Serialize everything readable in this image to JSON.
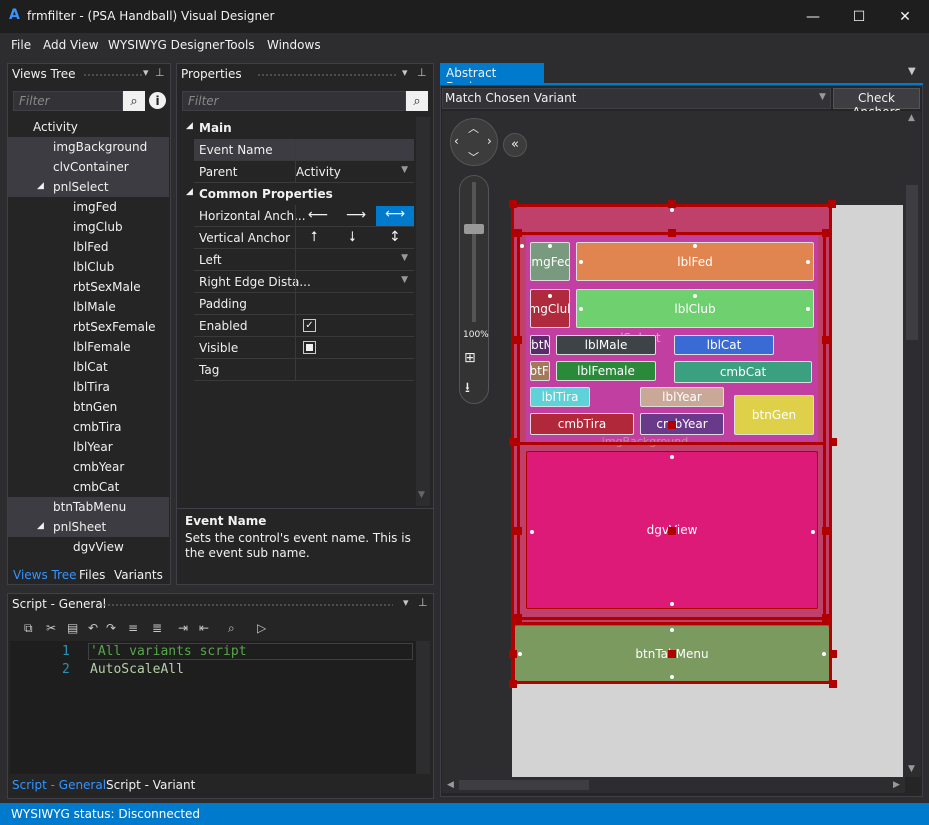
{
  "window": {
    "title": "frmfilter - (PSA Handball) Visual Designer",
    "logo": "A",
    "minimize": "—",
    "maximize": "☐",
    "close": "✕"
  },
  "menu": [
    "File",
    "Add View",
    "WYSIWYG Designer",
    "Tools",
    "Windows"
  ],
  "views_tree": {
    "title": "Views Tree",
    "filter_placeholder": "Filter",
    "items": [
      {
        "label": "Activity",
        "indent": 0
      },
      {
        "label": "imgBackground",
        "indent": 1
      },
      {
        "label": "clvContainer",
        "indent": 1
      },
      {
        "label": "pnlSelect",
        "indent": 1,
        "expanded": true
      },
      {
        "label": "imgFed",
        "indent": 2
      },
      {
        "label": "imgClub",
        "indent": 2
      },
      {
        "label": "lblFed",
        "indent": 2
      },
      {
        "label": "lblClub",
        "indent": 2
      },
      {
        "label": "rbtSexMale",
        "indent": 2
      },
      {
        "label": "lblMale",
        "indent": 2
      },
      {
        "label": "rbtSexFemale",
        "indent": 2
      },
      {
        "label": "lblFemale",
        "indent": 2
      },
      {
        "label": "lblCat",
        "indent": 2
      },
      {
        "label": "lblTira",
        "indent": 2
      },
      {
        "label": "btnGen",
        "indent": 2
      },
      {
        "label": "cmbTira",
        "indent": 2
      },
      {
        "label": "lblYear",
        "indent": 2
      },
      {
        "label": "cmbYear",
        "indent": 2
      },
      {
        "label": "cmbCat",
        "indent": 2
      },
      {
        "label": "btnTabMenu",
        "indent": 1
      },
      {
        "label": "pnlSheet",
        "indent": 1,
        "expanded": true
      },
      {
        "label": "dgvView",
        "indent": 2
      }
    ],
    "tabs": [
      "Views Tree",
      "Files",
      "Variants"
    ]
  },
  "properties": {
    "title": "Properties",
    "filter_placeholder": "Filter",
    "section_main": "Main",
    "event_name_label": "Event Name",
    "event_name_value": "",
    "parent_label": "Parent",
    "parent_value": "Activity",
    "section_common": "Common Properties",
    "horizontal_anchor_label": "Horizontal Anch...",
    "vertical_anchor_label": "Vertical Anchor",
    "left_label": "Left",
    "right_edge_label": "Right Edge Dista...",
    "padding_label": "Padding",
    "enabled_label": "Enabled",
    "enabled_checked": true,
    "visible_label": "Visible",
    "visible_checked": false,
    "tag_label": "Tag",
    "help_title": "Event Name",
    "help_text": "Sets the control's event name. This is the event sub name."
  },
  "script": {
    "title": "Script - General",
    "lines": [
      {
        "num": "1",
        "text": "'All variants script"
      },
      {
        "num": "2",
        "text": "AutoScaleAll"
      }
    ],
    "tabs": [
      "Script - General",
      "Script - Variant"
    ]
  },
  "designer": {
    "tab": "Abstract Designer",
    "variant_select": "Match Chosen Variant",
    "check_anchors": "Check Anchors",
    "zoom": "100%",
    "controls": {
      "imgFed": "imgFed",
      "lblFed": "lblFed",
      "imgClub": "imgClub",
      "lblClub": "lblClub",
      "pnlSelect": "pnlSelect",
      "rbtMale": "rbtM",
      "lblMale": "lblMale",
      "lblCat": "lblCat",
      "rbtFemale": "rbtFe",
      "lblFemale": "lblFemale",
      "cmbCat": "cmbCat",
      "lblTira": "lblTira",
      "lblYear": "lblYear",
      "btnGen": "btnGen",
      "cmbTira": "cmbTira",
      "cmbYear": "cmbYear",
      "imgBackground": "imgBackground",
      "dgvView": "dgvView",
      "btnTabMenu": "btnTabMenu"
    }
  },
  "status": "WYSIWYG status: Disconnected",
  "colors": {
    "accent": "#007acc",
    "selection_border": "#b00000",
    "panel_bg": "#c03fa0"
  }
}
